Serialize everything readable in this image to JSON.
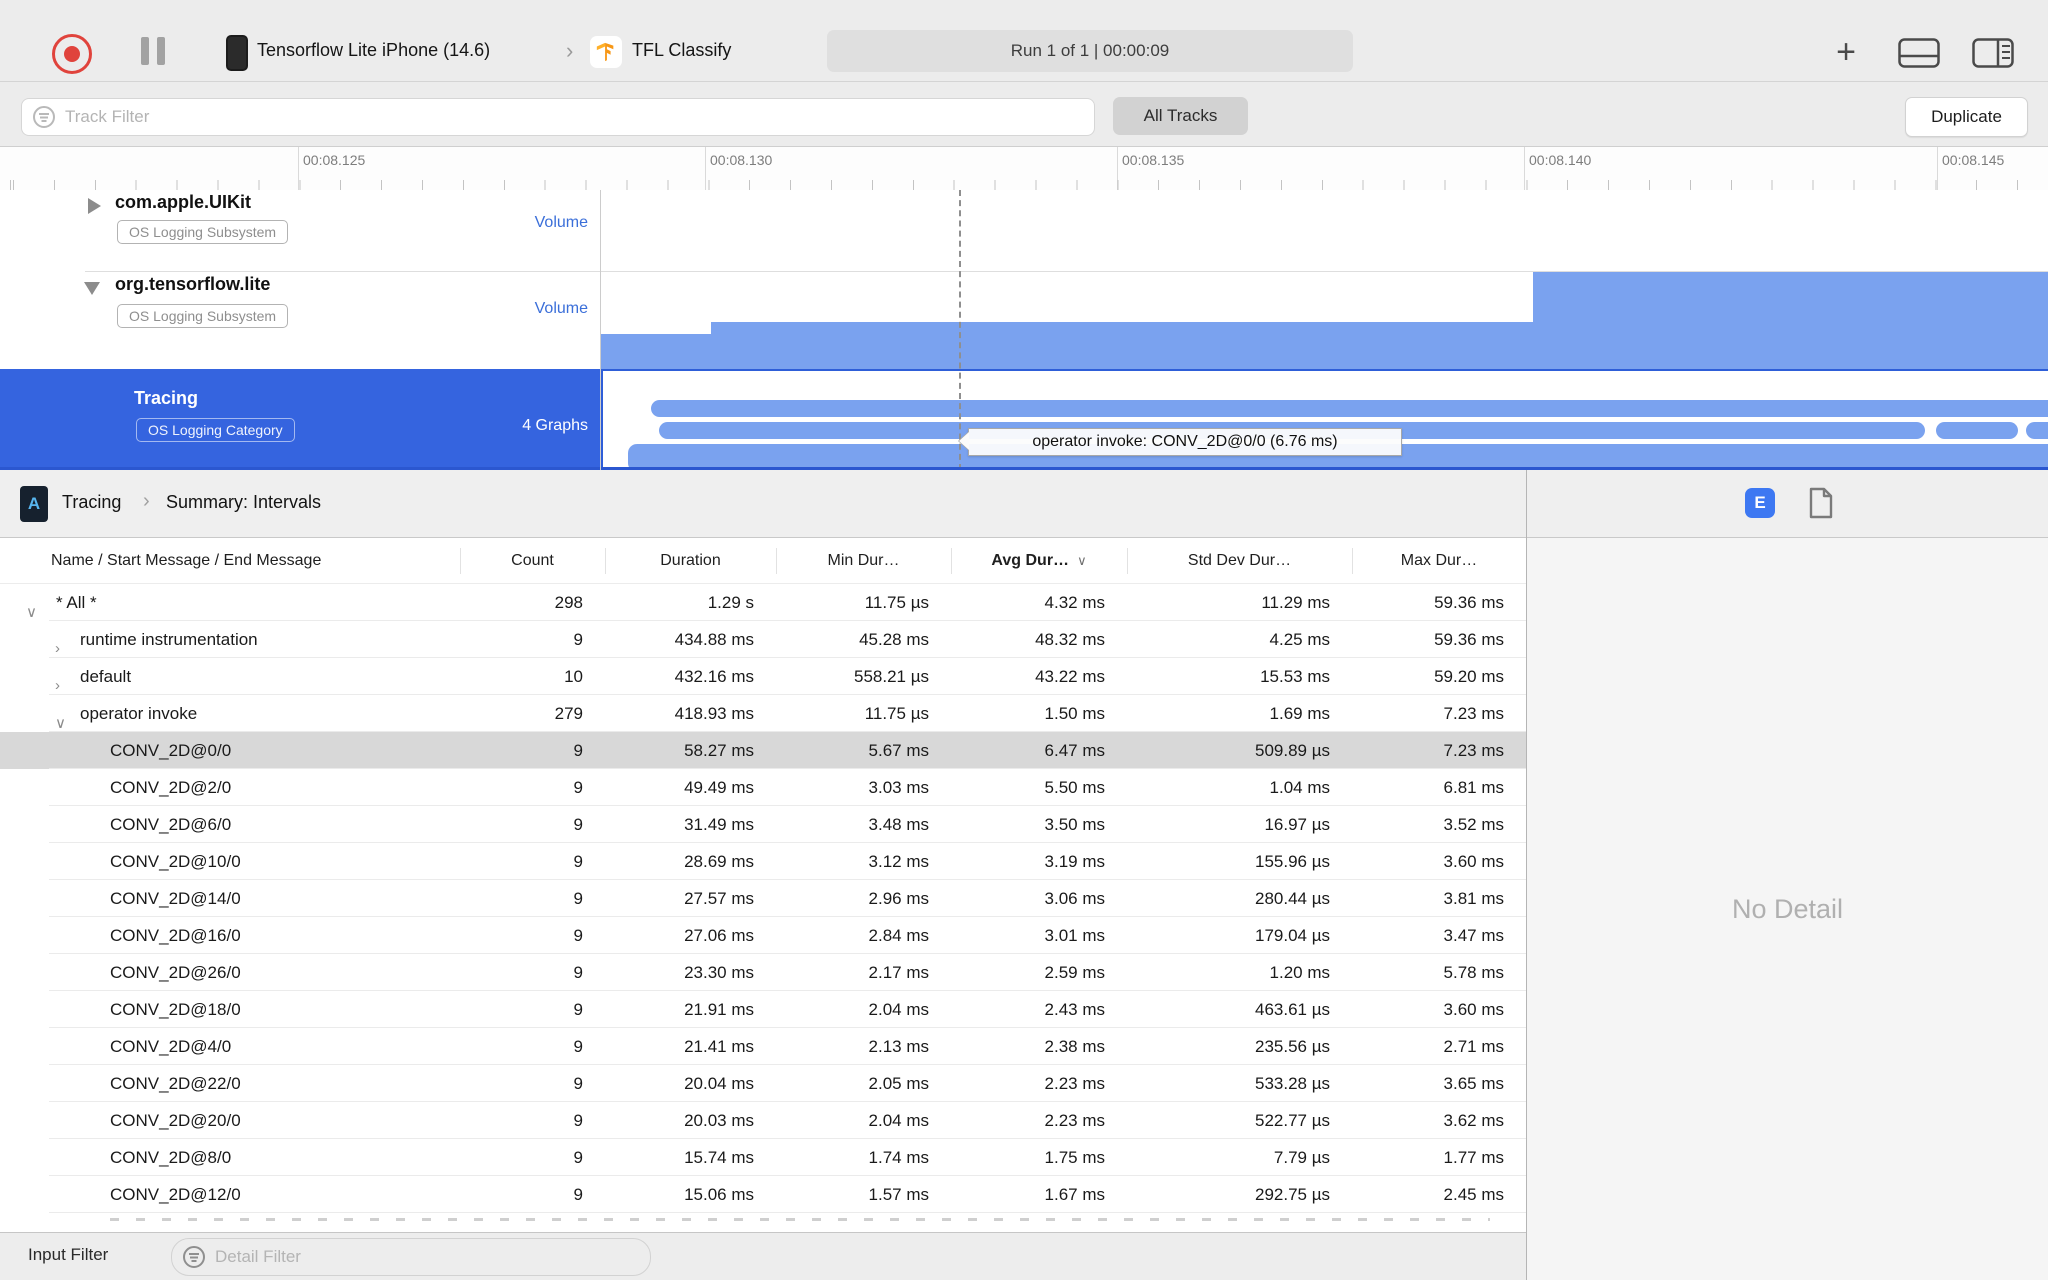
{
  "toolbar": {
    "device": "Tensorflow Lite iPhone (14.6)",
    "target": "TFL Classify",
    "run_status": "Run 1 of 1  |  00:00:09",
    "accent_record_color": "#e0433c"
  },
  "filter_bar": {
    "track_filter_placeholder": "Track Filter",
    "all_tracks_label": "All Tracks",
    "duplicate_label": "Duplicate"
  },
  "ruler": {
    "labels": [
      "00:08.125",
      "00:08.130",
      "00:08.135",
      "00:08.140",
      "00:08.145"
    ]
  },
  "tracks": [
    {
      "name": "com.apple.UIKit",
      "badge": "OS Logging Subsystem",
      "type_label": "Volume",
      "state": "collapsed"
    },
    {
      "name": "org.tensorflow.lite",
      "badge": "OS Logging Subsystem",
      "type_label": "Volume",
      "state": "expanded"
    },
    {
      "name": "Tracing",
      "badge": "OS Logging Category",
      "type_label": "4 Graphs",
      "state": "selected"
    }
  ],
  "tooltip": "operator invoke: CONV_2D@0/0 (6.76 ms)",
  "track_bar_color": "#7aa2ef",
  "selection_blue": "#3564df",
  "detail_header": {
    "crumb1": "Tracing",
    "crumb2": "Summary: Intervals",
    "extended_detail_badge": "E"
  },
  "table": {
    "columns": [
      "Name / Start Message / End Message",
      "Count",
      "Duration",
      "Min Dur…",
      "Avg Dur…",
      "Std Dev Dur…",
      "Max Dur…"
    ],
    "sorted_column": "Avg Dur…",
    "rows": [
      {
        "name": "* All *",
        "count": "298",
        "duration": "1.29 s",
        "min": "11.75 µs",
        "avg": "4.32 ms",
        "std": "11.29 ms",
        "max": "59.36 ms",
        "indent": 1,
        "chevron": "down",
        "selected": false
      },
      {
        "name": "runtime instrumentation",
        "count": "9",
        "duration": "434.88 ms",
        "min": "45.28 ms",
        "avg": "48.32 ms",
        "std": "4.25 ms",
        "max": "59.36 ms",
        "indent": 2,
        "chevron": "right",
        "selected": false
      },
      {
        "name": "default",
        "count": "10",
        "duration": "432.16 ms",
        "min": "558.21 µs",
        "avg": "43.22 ms",
        "std": "15.53 ms",
        "max": "59.20 ms",
        "indent": 2,
        "chevron": "right",
        "selected": false
      },
      {
        "name": "operator invoke",
        "count": "279",
        "duration": "418.93 ms",
        "min": "11.75 µs",
        "avg": "1.50 ms",
        "std": "1.69 ms",
        "max": "7.23 ms",
        "indent": 2,
        "chevron": "down",
        "selected": false
      },
      {
        "name": "CONV_2D@0/0",
        "count": "9",
        "duration": "58.27 ms",
        "min": "5.67 ms",
        "avg": "6.47 ms",
        "std": "509.89 µs",
        "max": "7.23 ms",
        "indent": 3,
        "chevron": "",
        "selected": true
      },
      {
        "name": "CONV_2D@2/0",
        "count": "9",
        "duration": "49.49 ms",
        "min": "3.03 ms",
        "avg": "5.50 ms",
        "std": "1.04 ms",
        "max": "6.81 ms",
        "indent": 3,
        "chevron": "",
        "selected": false
      },
      {
        "name": "CONV_2D@6/0",
        "count": "9",
        "duration": "31.49 ms",
        "min": "3.48 ms",
        "avg": "3.50 ms",
        "std": "16.97 µs",
        "max": "3.52 ms",
        "indent": 3,
        "chevron": "",
        "selected": false
      },
      {
        "name": "CONV_2D@10/0",
        "count": "9",
        "duration": "28.69 ms",
        "min": "3.12 ms",
        "avg": "3.19 ms",
        "std": "155.96 µs",
        "max": "3.60 ms",
        "indent": 3,
        "chevron": "",
        "selected": false
      },
      {
        "name": "CONV_2D@14/0",
        "count": "9",
        "duration": "27.57 ms",
        "min": "2.96 ms",
        "avg": "3.06 ms",
        "std": "280.44 µs",
        "max": "3.81 ms",
        "indent": 3,
        "chevron": "",
        "selected": false
      },
      {
        "name": "CONV_2D@16/0",
        "count": "9",
        "duration": "27.06 ms",
        "min": "2.84 ms",
        "avg": "3.01 ms",
        "std": "179.04 µs",
        "max": "3.47 ms",
        "indent": 3,
        "chevron": "",
        "selected": false
      },
      {
        "name": "CONV_2D@26/0",
        "count": "9",
        "duration": "23.30 ms",
        "min": "2.17 ms",
        "avg": "2.59 ms",
        "std": "1.20 ms",
        "max": "5.78 ms",
        "indent": 3,
        "chevron": "",
        "selected": false
      },
      {
        "name": "CONV_2D@18/0",
        "count": "9",
        "duration": "21.91 ms",
        "min": "2.04 ms",
        "avg": "2.43 ms",
        "std": "463.61 µs",
        "max": "3.60 ms",
        "indent": 3,
        "chevron": "",
        "selected": false
      },
      {
        "name": "CONV_2D@4/0",
        "count": "9",
        "duration": "21.41 ms",
        "min": "2.13 ms",
        "avg": "2.38 ms",
        "std": "235.56 µs",
        "max": "2.71 ms",
        "indent": 3,
        "chevron": "",
        "selected": false
      },
      {
        "name": "CONV_2D@22/0",
        "count": "9",
        "duration": "20.04 ms",
        "min": "2.05 ms",
        "avg": "2.23 ms",
        "std": "533.28 µs",
        "max": "3.65 ms",
        "indent": 3,
        "chevron": "",
        "selected": false
      },
      {
        "name": "CONV_2D@20/0",
        "count": "9",
        "duration": "20.03 ms",
        "min": "2.04 ms",
        "avg": "2.23 ms",
        "std": "522.77 µs",
        "max": "3.62 ms",
        "indent": 3,
        "chevron": "",
        "selected": false
      },
      {
        "name": "CONV_2D@8/0",
        "count": "9",
        "duration": "15.74 ms",
        "min": "1.74 ms",
        "avg": "1.75 ms",
        "std": "7.79 µs",
        "max": "1.77 ms",
        "indent": 3,
        "chevron": "",
        "selected": false
      },
      {
        "name": "CONV_2D@12/0",
        "count": "9",
        "duration": "15.06 ms",
        "min": "1.57 ms",
        "avg": "1.67 ms",
        "std": "292.75 µs",
        "max": "2.45 ms",
        "indent": 3,
        "chevron": "",
        "selected": false
      }
    ]
  },
  "right_panel": {
    "no_detail": "No Detail"
  },
  "bottom_bar": {
    "input_filter_label": "Input Filter",
    "detail_filter_placeholder": "Detail Filter"
  }
}
